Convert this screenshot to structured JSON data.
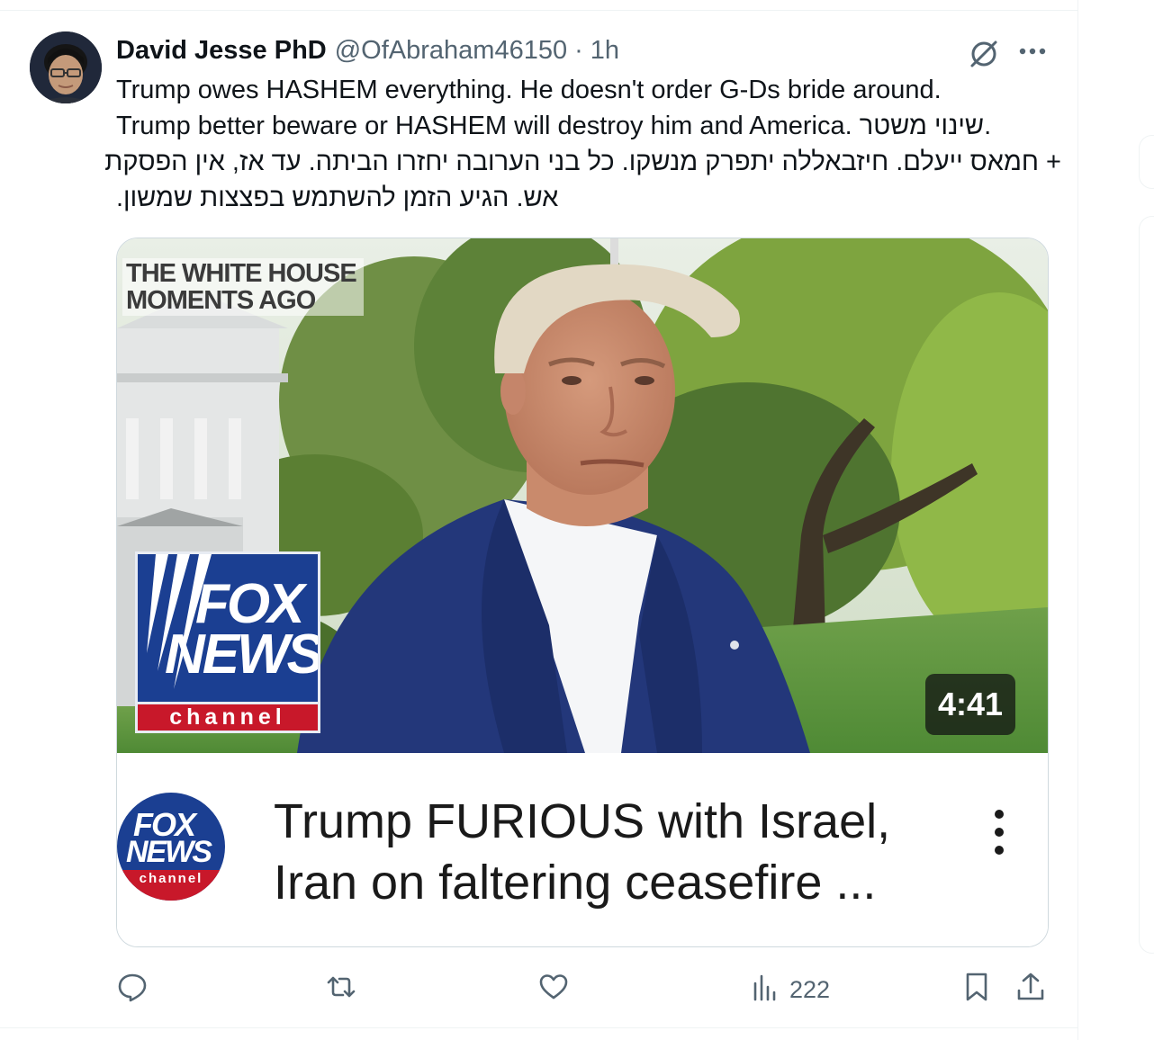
{
  "tweet": {
    "author_name": "David Jesse PhD",
    "author_handle": "@OfAbraham46150",
    "separator": "·",
    "time": "1h",
    "text_lines": [
      "Trump owes HASHEM everything. He doesn't order G-Ds bride around.",
      "Trump better beware or HASHEM will destroy him and America. שינוי משטר.",
      "+ חמאס ייעלם. חיזבאללה יתפרק מנשקו. כל בני הערובה יחזרו הביתה. עד אז, אין הפסקת",
      "אש. הגיע הזמן להשתמש בפצצות שמשון."
    ]
  },
  "video_card": {
    "overlay_line1": "THE WHITE HOUSE",
    "overlay_line2": "MOMENTS AGO",
    "logo_fox": "FOX",
    "logo_news": "NEWS",
    "logo_channel": "channel",
    "duration": "4:41",
    "title_line1": "Trump FURIOUS with Israel,",
    "title_line2": "Iran on faltering ceasefire ...",
    "channel_fox": "FOX",
    "channel_news": "NEWS",
    "channel_channel": "channel"
  },
  "actions": {
    "views_count": "222"
  },
  "icons": {
    "grok": "grok-slash-circle-icon",
    "more": "more-dots-icon",
    "reply": "reply-bubble-icon",
    "retweet": "retweet-icon",
    "like": "heart-icon",
    "views": "views-bar-chart-icon",
    "bookmark": "bookmark-icon",
    "share": "share-upload-icon"
  },
  "colors": {
    "text_primary": "#0f1419",
    "text_secondary": "#536471",
    "border": "#cfd9de",
    "fox_blue": "#1b3f92",
    "fox_red": "#c8182a"
  }
}
